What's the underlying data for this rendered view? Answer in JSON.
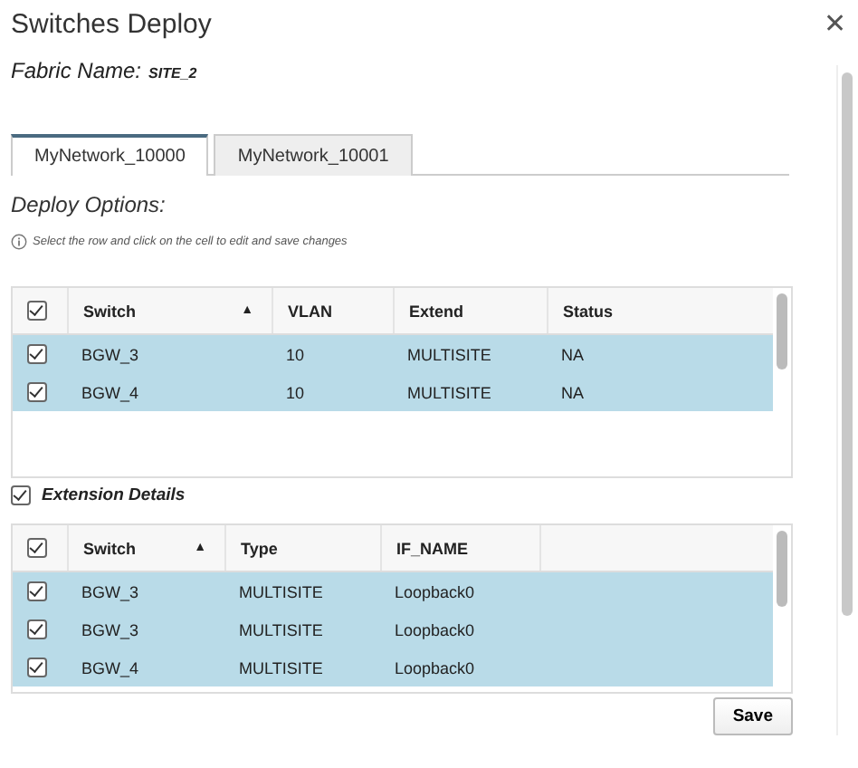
{
  "dialog": {
    "title": "Switches Deploy",
    "close": "✕"
  },
  "fabric": {
    "label": "Fabric Name:",
    "value": "SITE_2"
  },
  "tabs": [
    {
      "label": "MyNetwork_10000",
      "selected": true
    },
    {
      "label": "MyNetwork_10001",
      "selected": false
    }
  ],
  "deploy_options": {
    "heading": "Deploy Options:",
    "hint": "Select the row and click on the cell to edit and save changes"
  },
  "switch_table": {
    "all_checked": true,
    "columns": [
      {
        "label": "Switch",
        "sort": "▲"
      },
      {
        "label": "VLAN"
      },
      {
        "label": "Extend"
      },
      {
        "label": "Status"
      }
    ],
    "rows": [
      {
        "checked": true,
        "selected": true,
        "cells": [
          "BGW_3",
          "10",
          "MULTISITE",
          "NA"
        ]
      },
      {
        "checked": true,
        "selected": true,
        "cells": [
          "BGW_4",
          "10",
          "MULTISITE",
          "NA"
        ]
      }
    ]
  },
  "extension_details": {
    "label": "Extension Details",
    "checked": true
  },
  "extension_table": {
    "all_checked": true,
    "columns": [
      {
        "label": "Switch",
        "sort": "▲"
      },
      {
        "label": "Type"
      },
      {
        "label": "IF_NAME"
      }
    ],
    "rows": [
      {
        "checked": true,
        "selected": true,
        "cells": [
          "BGW_3",
          "MULTISITE",
          "Loopback0"
        ]
      },
      {
        "checked": true,
        "selected": true,
        "cells": [
          "BGW_3",
          "MULTISITE",
          "Loopback0"
        ]
      },
      {
        "checked": true,
        "selected": true,
        "cells": [
          "BGW_4",
          "MULTISITE",
          "Loopback0"
        ]
      }
    ]
  },
  "save_button": "Save"
}
